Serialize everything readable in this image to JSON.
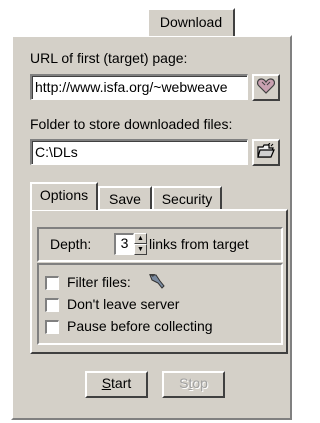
{
  "window": {
    "tab_label": "Download"
  },
  "url": {
    "label": "URL of first (target) page:",
    "value": "http://www.isfa.org/~webweave",
    "button_icon": "heart-icon"
  },
  "folder": {
    "label": "Folder to store downloaded files:",
    "value": "C:\\DLs",
    "button_icon": "open-folder-icon"
  },
  "inner_tabs": [
    {
      "label": "Options",
      "active": true
    },
    {
      "label": "Save",
      "active": false
    },
    {
      "label": "Security",
      "active": false
    }
  ],
  "depth": {
    "label": "Depth:",
    "value": "3",
    "suffix": "links from target"
  },
  "options": {
    "filter_files": {
      "label": "Filter files:",
      "checked": false,
      "icon": "filter-icon"
    },
    "dont_leave_server": {
      "label": "Don't leave server",
      "checked": false
    },
    "pause_before_collecting": {
      "label": "Pause before collecting",
      "checked": false
    }
  },
  "buttons": {
    "start": {
      "mnemonic": "S",
      "rest": "tart",
      "enabled": true
    },
    "stop": {
      "mnemonic": "t",
      "pre": "S",
      "rest": "op",
      "enabled": false
    }
  }
}
